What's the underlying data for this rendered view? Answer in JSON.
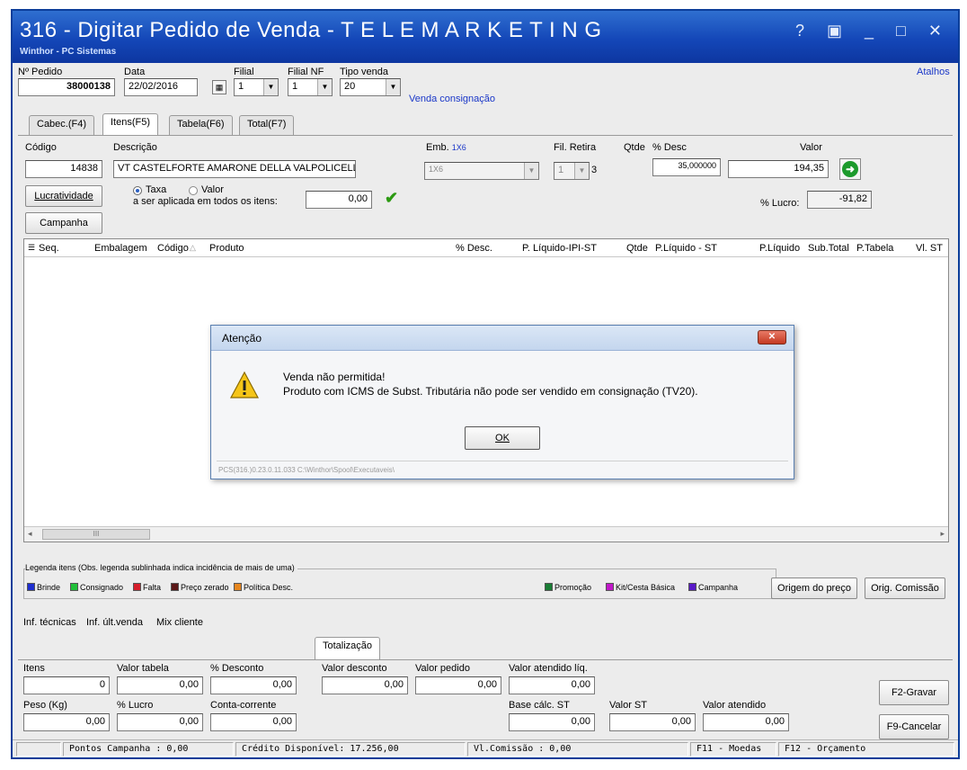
{
  "window": {
    "title": "316 - Digitar Pedido de Venda - T E L E M A R K E T I N G",
    "subtitle": "Winthor - PC Sistemas",
    "controls": "? ▣ _ □ ✕"
  },
  "header": {
    "pedido_label": "Nº Pedido",
    "pedido_value": "38000138",
    "data_label": "Data",
    "data_value": "22/02/2016",
    "filial_label": "Filial",
    "filial_value": "1",
    "filial_nf_label": "Filial NF",
    "filial_nf_value": "1",
    "tipo_venda_label": "Tipo venda",
    "tipo_venda_value": "20",
    "venda_link": "Venda consignação",
    "atalhos": "Atalhos"
  },
  "tabs": [
    {
      "label": "Cabec.(F4)"
    },
    {
      "label": "Itens(F5)"
    },
    {
      "label": "Tabela(F6)"
    },
    {
      "label": "Total(F7)"
    }
  ],
  "item": {
    "codigo_label": "Código",
    "codigo_value": "14838",
    "descricao_label": "Descrição",
    "descricao_value": "VT CASTELFORTE AMARONE DELLA VALPOLICELL",
    "emb_label": "Emb.",
    "emb_code": "1X6",
    "emb_value": "1X6",
    "fil_retira_label": "Fil. Retira",
    "fil_retira_value": "1",
    "qtde_label": "Qtde",
    "qtde_value": "3",
    "desc_label": "% Desc",
    "desc_value": "35,000000",
    "valor_label": "Valor",
    "valor_value": "194,35",
    "lucratividade_button": "Lucratividade",
    "campanha_button": "Campanha",
    "taxa_label": "Taxa",
    "valor_radio_label": "Valor",
    "aplicada_label": "a ser aplicada em todos os itens:",
    "aplicada_value": "0,00",
    "lucro_label": "% Lucro:",
    "lucro_value": "-91,82"
  },
  "grid": {
    "columns": [
      "Seq.",
      "Embalagem",
      "Código",
      "Produto",
      "% Desc.",
      "P. Líquido-IPI-ST",
      "Qtde",
      "P.Líquido - ST",
      "P.Líquido",
      "Sub.Total",
      "P.Tabela",
      "Vl. ST"
    ],
    "scroll_marker": "III"
  },
  "dialog": {
    "title": "Atenção",
    "line1": "Venda não permitida!",
    "line2": "Produto com ICMS de Subst. Tributária não pode ser vendido em consignação (TV20).",
    "ok_label": "OK",
    "path": "PCS(316.)0.23.0.11.033  C:\\Winthor\\Spool\\Executaveis\\"
  },
  "legend": {
    "title": "Legenda itens (Obs. legenda sublinhada indica incidência de mais de uma)",
    "items_left": [
      {
        "label": "Brinde",
        "color": "#1f2fd0"
      },
      {
        "label": "Consignado",
        "color": "#22c03a"
      },
      {
        "label": "Falta",
        "color": "#d61f2c"
      },
      {
        "label": "Preço zerado",
        "color": "#5b1818"
      },
      {
        "label": "Política Desc.",
        "color": "#e6861f"
      }
    ],
    "items_right": [
      {
        "label": "Promoção",
        "color": "#1a7d35"
      },
      {
        "label": "Kit/Cesta Básica",
        "color": "#c018c8"
      },
      {
        "label": "Campanha",
        "color": "#5a1ac8"
      }
    ],
    "origem_preco_button": "Origem do preço",
    "orig_comissao_button": "Orig. Comissão"
  },
  "info_links": [
    "Inf. técnicas",
    "Inf. últ.venda",
    "Mix cliente"
  ],
  "totalizacao": {
    "tab_label": "Totalização",
    "itens_label": "Itens",
    "itens_value": "0",
    "valor_tabela_label": "Valor tabela",
    "valor_tabela_value": "0,00",
    "pct_desconto_label": "% Desconto",
    "pct_desconto_value": "0,00",
    "valor_desconto_label": "Valor desconto",
    "valor_desconto_value": "0,00",
    "valor_pedido_label": "Valor pedido",
    "valor_pedido_value": "0,00",
    "valor_atendido_liq_label": "Valor atendido líq.",
    "valor_atendido_liq_value": "0,00",
    "peso_label": "Peso (Kg)",
    "peso_value": "0,00",
    "pct_lucro_label": "% Lucro",
    "pct_lucro_value": "0,00",
    "conta_corrente_label": "Conta-corrente",
    "conta_corrente_value": "0,00",
    "base_st_label": "Base cálc. ST",
    "base_st_value": "0,00",
    "valor_st_label": "Valor ST",
    "valor_st_value": "0,00",
    "valor_atendido_label": "Valor atendido",
    "valor_atendido_value": "0,00",
    "gravar_button": "F2-Gravar",
    "cancelar_button": "F9-Cancelar"
  },
  "statusbar": {
    "pontos": "Pontos Campanha : 0,00",
    "credito": "Crédito Disponível: 17.256,00",
    "comissao": "Vl.Comissão : 0,00",
    "moedas": "F11 - Moedas",
    "orcamento": "F12 - Orçamento"
  }
}
